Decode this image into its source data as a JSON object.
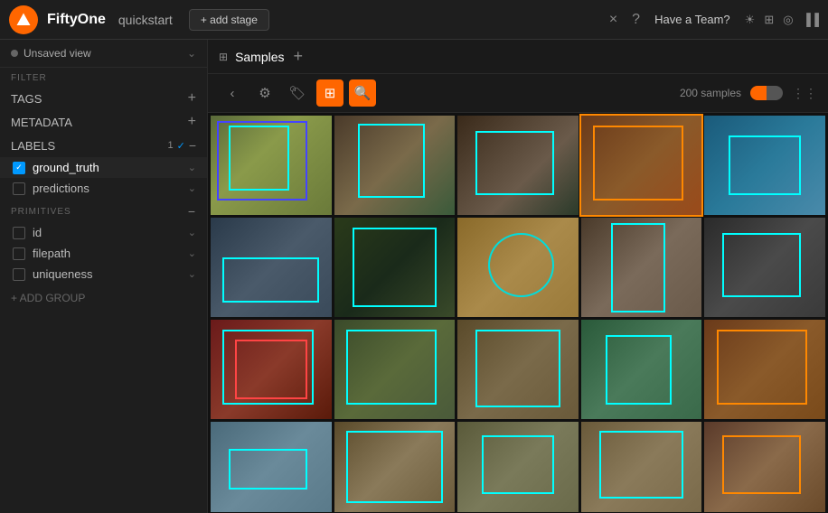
{
  "topbar": {
    "app_name": "FiftyOne",
    "dataset_name": "quickstart",
    "add_stage_label": "+ add stage",
    "team_label": "Have a Team?",
    "close_label": "×",
    "help_label": "?"
  },
  "sidebar": {
    "view_label": "Unsaved view",
    "filter_label": "FILTER",
    "tags_label": "TAGS",
    "metadata_label": "METADATA",
    "labels_label": "LABELS",
    "labels_count": "1",
    "primitives_label": "PRIMITIVES",
    "ground_truth_label": "ground_truth",
    "predictions_label": "predictions",
    "id_label": "id",
    "filepath_label": "filepath",
    "uniqueness_label": "uniqueness",
    "add_group_label": "+ ADD GROUP"
  },
  "toolbar": {
    "back_label": "‹",
    "settings_label": "⚙",
    "tag_label": "🏷",
    "sample_count": "200 samples"
  },
  "grid": {
    "title": "Samples"
  }
}
